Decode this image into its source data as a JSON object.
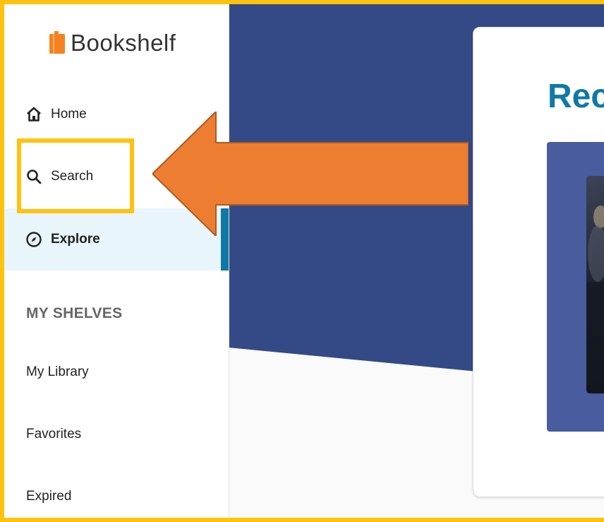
{
  "brand": {
    "name": "Bookshelf"
  },
  "sidebar": {
    "nav": [
      {
        "label": "Home",
        "icon": "home-icon"
      },
      {
        "label": "Search",
        "icon": "search-icon"
      },
      {
        "label": "Explore",
        "icon": "compass-icon",
        "active": true
      }
    ],
    "section_title": "MY SHELVES",
    "shelves": [
      {
        "label": "My Library"
      },
      {
        "label": "Favorites"
      },
      {
        "label": "Expired"
      }
    ]
  },
  "main": {
    "card_title": "Rec"
  },
  "annotation": {
    "type": "arrow-pointing-left",
    "target": "Search"
  },
  "colors": {
    "highlight_border": "#FFC20E",
    "arrow_fill": "#ED7D31",
    "arrow_stroke": "#AE5A21",
    "banner": "#334a87",
    "accent": "#0f79a6",
    "active_bg": "#e8f5fb",
    "logo": "#F58220",
    "rec_panel": "#485c9e"
  }
}
